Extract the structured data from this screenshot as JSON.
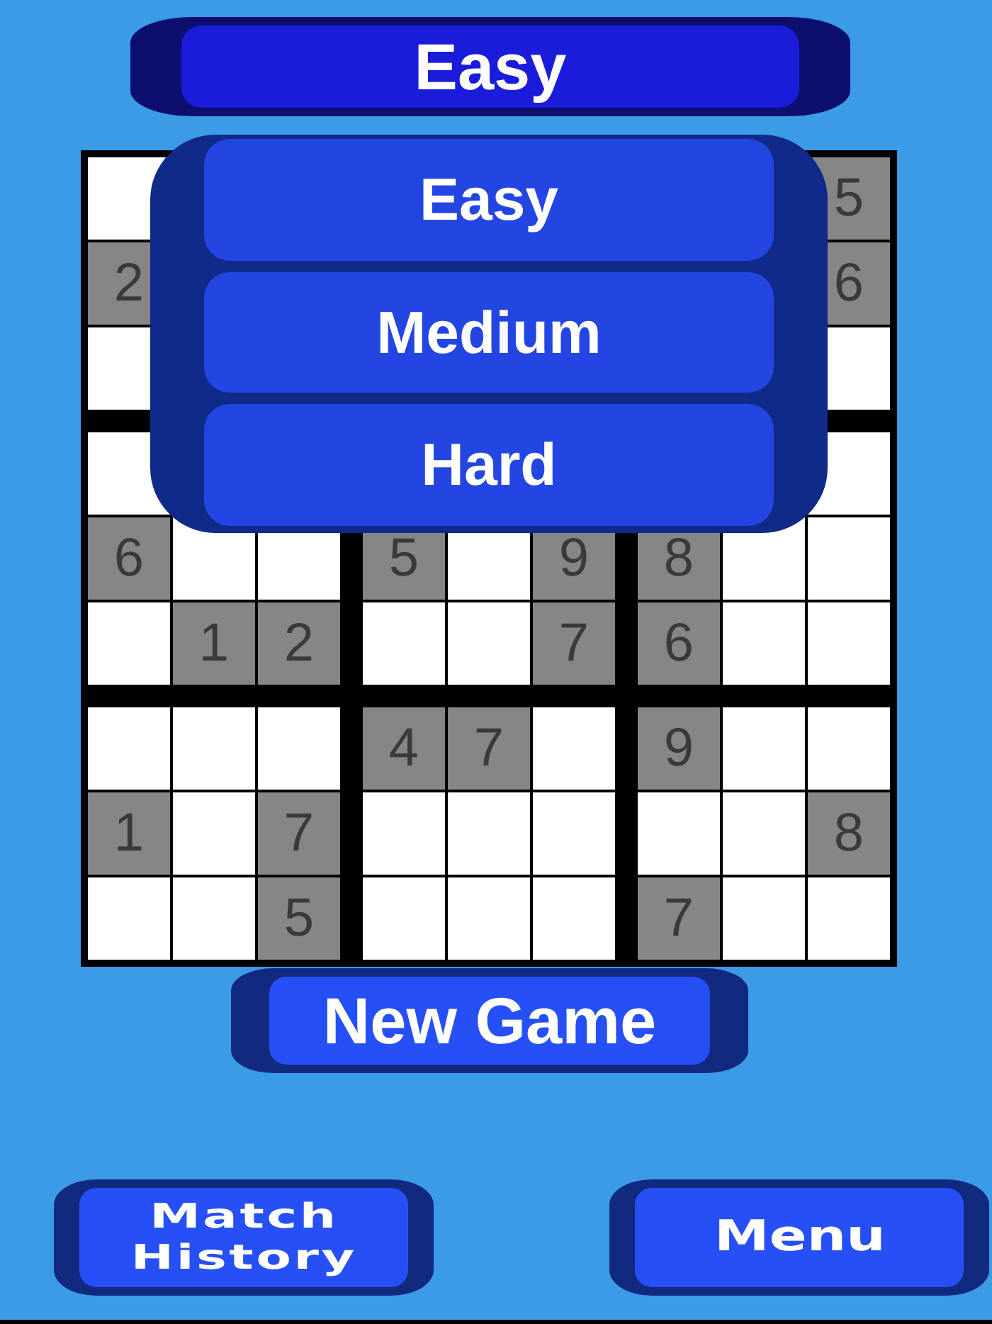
{
  "difficulty_selector": {
    "value": "Easy",
    "expanded": true,
    "options": [
      "Easy",
      "Medium",
      "Hard"
    ]
  },
  "board": {
    "rows": [
      [
        {
          "given": false
        },
        null,
        null,
        null,
        null,
        null,
        null,
        null,
        {
          "digit": "5",
          "given": true
        }
      ],
      [
        {
          "digit": "2",
          "given": true
        },
        null,
        null,
        null,
        null,
        null,
        null,
        null,
        {
          "digit": "6",
          "given": true
        }
      ],
      [
        {
          "given": false
        },
        null,
        null,
        null,
        null,
        null,
        null,
        null,
        {
          "given": false
        }
      ],
      [
        {
          "given": false
        },
        null,
        null,
        null,
        null,
        null,
        null,
        null,
        {
          "given": false
        }
      ],
      [
        {
          "digit": "6",
          "given": true
        },
        {
          "given": false
        },
        {
          "given": false
        },
        {
          "digit": "5",
          "given": true
        },
        {
          "given": false
        },
        {
          "digit": "9",
          "given": true
        },
        {
          "digit": "8",
          "given": true
        },
        {
          "given": false
        },
        {
          "given": false
        }
      ],
      [
        {
          "given": false
        },
        {
          "digit": "1",
          "given": true
        },
        {
          "digit": "2",
          "given": true
        },
        {
          "given": false
        },
        {
          "given": false
        },
        {
          "digit": "7",
          "given": true
        },
        {
          "digit": "6",
          "given": true
        },
        {
          "given": false
        },
        {
          "given": false
        }
      ],
      [
        {
          "given": false
        },
        {
          "given": false
        },
        {
          "given": false
        },
        {
          "digit": "4",
          "given": true
        },
        {
          "digit": "7",
          "given": true
        },
        {
          "given": false
        },
        {
          "digit": "9",
          "given": true
        },
        {
          "given": false
        },
        {
          "given": false
        }
      ],
      [
        {
          "digit": "1",
          "given": true
        },
        {
          "given": false
        },
        {
          "digit": "7",
          "given": true
        },
        {
          "given": false
        },
        {
          "given": false
        },
        {
          "given": false
        },
        {
          "given": false
        },
        {
          "given": false
        },
        {
          "digit": "8",
          "given": true
        }
      ],
      [
        {
          "given": false
        },
        {
          "given": false
        },
        {
          "digit": "5",
          "given": true
        },
        {
          "given": false
        },
        {
          "given": false
        },
        {
          "given": false
        },
        {
          "digit": "7",
          "given": true
        },
        {
          "given": false
        },
        {
          "given": false
        }
      ]
    ]
  },
  "new_game_button": {
    "label": "New Game"
  },
  "bottom_buttons": [
    {
      "label": "Match History",
      "kind": "history"
    },
    {
      "label": "Menu",
      "kind": "menu"
    }
  ]
}
